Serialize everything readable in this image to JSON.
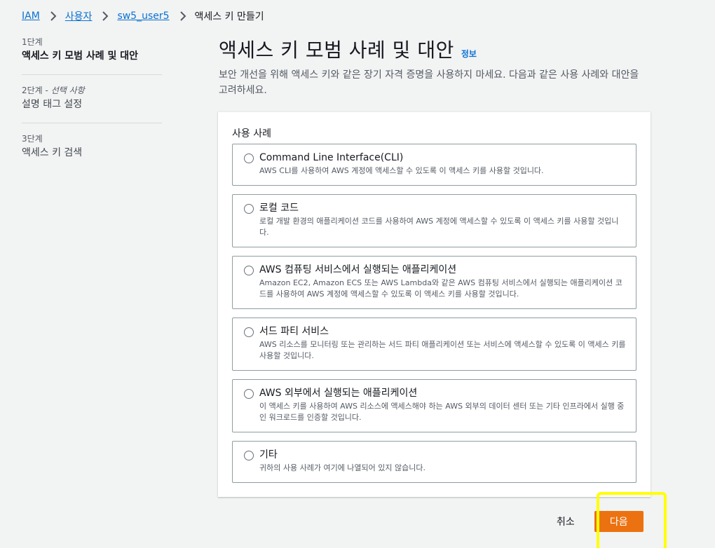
{
  "breadcrumb": {
    "items": [
      "IAM",
      "사용자",
      "sw5_user5"
    ],
    "current": "액세스 키 만들기"
  },
  "steps": [
    {
      "label": "1단계",
      "optional": "",
      "title": "액세스 키 모범 사례 및 대안"
    },
    {
      "label": "2단계 - ",
      "optional": "선택 사항",
      "title": "설명 태그 설정"
    },
    {
      "label": "3단계",
      "optional": "",
      "title": "액세스 키 검색"
    }
  ],
  "page": {
    "title": "액세스 키 모범 사례 및 대안",
    "info": "정보",
    "description": "보안 개선을 위해 액세스 키와 같은 장기 자격 증명을 사용하지 마세요. 다음과 같은 사용 사례와 대안을 고려하세요."
  },
  "use_cases": {
    "label": "사용 사례",
    "options": [
      {
        "title": "Command Line Interface(CLI)",
        "desc": "AWS CLI를 사용하여 AWS 계정에 액세스할 수 있도록 이 액세스 키를 사용할 것입니다."
      },
      {
        "title": "로컬 코드",
        "desc": "로컬 개발 환경의 애플리케이션 코드를 사용하여 AWS 계정에 액세스할 수 있도록 이 액세스 키를 사용할 것입니다."
      },
      {
        "title": "AWS 컴퓨팅 서비스에서 실행되는 애플리케이션",
        "desc": "Amazon EC2, Amazon ECS 또는 AWS Lambda와 같은 AWS 컴퓨팅 서비스에서 실행되는 애플리케이션 코드를 사용하여 AWS 계정에 액세스할 수 있도록 이 액세스 키를 사용할 것입니다."
      },
      {
        "title": "서드 파티 서비스",
        "desc": "AWS 리소스를 모니터링 또는 관리하는 서드 파티 애플리케이션 또는 서비스에 액세스할 수 있도록 이 액세스 키를 사용할 것입니다."
      },
      {
        "title": "AWS 외부에서 실행되는 애플리케이션",
        "desc": "이 액세스 키를 사용하여 AWS 리소스에 액세스해야 하는 AWS 외부의 데이터 센터 또는 기타 인프라에서 실행 중인 워크로드를 인증할 것입니다."
      },
      {
        "title": "기타",
        "desc": "귀하의 사용 사례가 여기에 나열되어 있지 않습니다."
      }
    ]
  },
  "actions": {
    "cancel": "취소",
    "next": "다음"
  },
  "colors": {
    "link": "#0972d3",
    "primary": "#ec7211",
    "highlight": "#ffff00",
    "background": "#f2f3f3"
  }
}
